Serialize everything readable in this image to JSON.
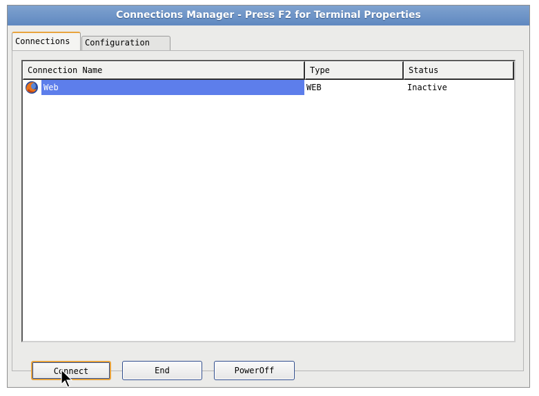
{
  "window": {
    "title": "Connections Manager - Press F2 for Terminal Properties"
  },
  "tabs": [
    {
      "label": "Connections",
      "active": true
    },
    {
      "label": "Configuration",
      "active": false
    }
  ],
  "table": {
    "columns": [
      "Connection Name",
      "Type",
      "Status"
    ],
    "rows": [
      {
        "icon": "firefox-icon",
        "name": "Web",
        "type": "WEB",
        "status": "Inactive",
        "selected": true
      }
    ]
  },
  "buttons": {
    "connect": "Connect",
    "end": "End",
    "poweroff": "PowerOff"
  },
  "colors": {
    "selection": "#5d7eeb",
    "focus_accent": "#e8a33c",
    "titlebar": "#6b92c6"
  }
}
